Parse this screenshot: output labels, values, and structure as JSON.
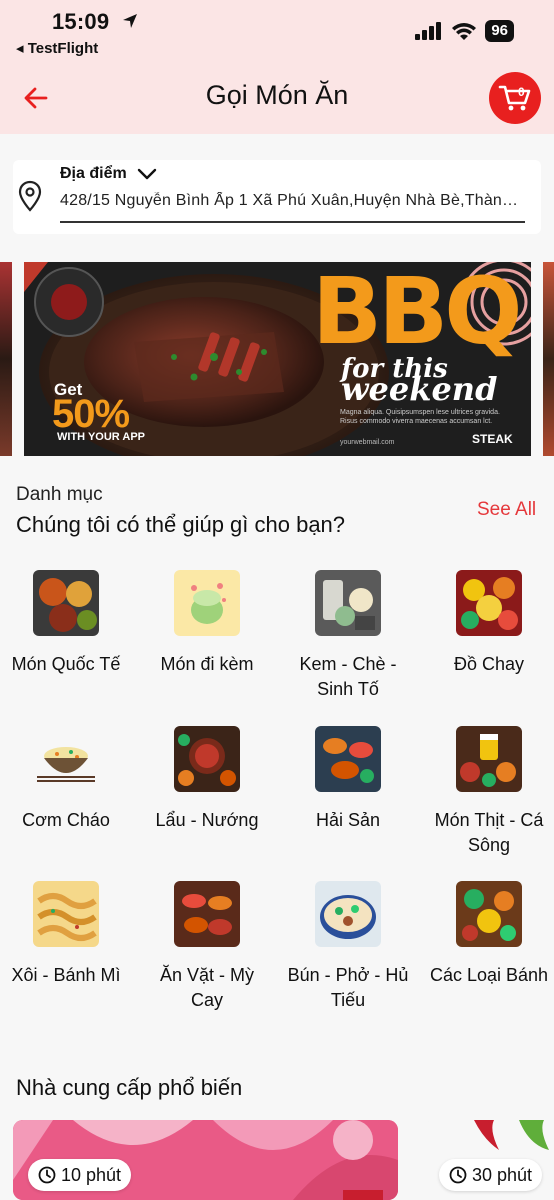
{
  "status_bar": {
    "time": "15:09",
    "back_app": "◂ TestFlight",
    "battery": "96"
  },
  "header": {
    "title": "Gọi Món Ăn",
    "cart_count": "0"
  },
  "location": {
    "label": "Địa điểm",
    "address": "428/15 Nguyễn Bình Ấp 1 Xã Phú Xuân,Huyện Nhà Bè,Thành Phố Hồ Chí Minh"
  },
  "banner": {
    "headline": "BBQ",
    "line1": "for this",
    "line2": "weekend",
    "promo_get": "Get",
    "promo_percent": "50%",
    "promo_app": "WITH YOUR APP",
    "small_copy": "Magna aliqua. Quisipsumspen lese ultrices gravida. Risus commodo viverra maecenas accumsan lct.",
    "website": "yourwebmail.com",
    "brand": "STEAK"
  },
  "categories": {
    "subtitle": "Danh mục",
    "title": "Chúng tôi có thể giúp gì cho bạn?",
    "see_all": "See All",
    "items": [
      {
        "label": "Món Quốc Tế",
        "icon": "international-food-icon"
      },
      {
        "label": "Món đi kèm",
        "icon": "side-dish-icon"
      },
      {
        "label": "Kem - Chè - Sinh Tố",
        "icon": "dessert-icon"
      },
      {
        "label": "Đồ Chay",
        "icon": "vegetarian-icon"
      },
      {
        "label": "Cơm Cháo",
        "icon": "rice-porridge-icon"
      },
      {
        "label": "Lẩu - Nướng",
        "icon": "hotpot-grill-icon"
      },
      {
        "label": "Hải Sản",
        "icon": "seafood-icon"
      },
      {
        "label": "Món Thịt - Cá Sông",
        "icon": "meat-fish-icon"
      },
      {
        "label": "Xôi - Bánh Mì",
        "icon": "sticky-rice-bread-icon"
      },
      {
        "label": "Ăn Vặt - Mỳ Cay",
        "icon": "snack-noodle-icon"
      },
      {
        "label": "Bún - Phở - Hủ Tiếu",
        "icon": "noodle-soup-icon"
      },
      {
        "label": "Các Loại Bánh",
        "icon": "cake-icon"
      }
    ]
  },
  "suppliers": {
    "title": "Nhà cung cấp phổ biến",
    "cards": [
      {
        "time": "10 phút"
      },
      {
        "time": "30 phút"
      }
    ]
  },
  "colors": {
    "accent": "#e8201f",
    "header_bg": "#fbe5e5",
    "see_all": "#e5383b"
  }
}
